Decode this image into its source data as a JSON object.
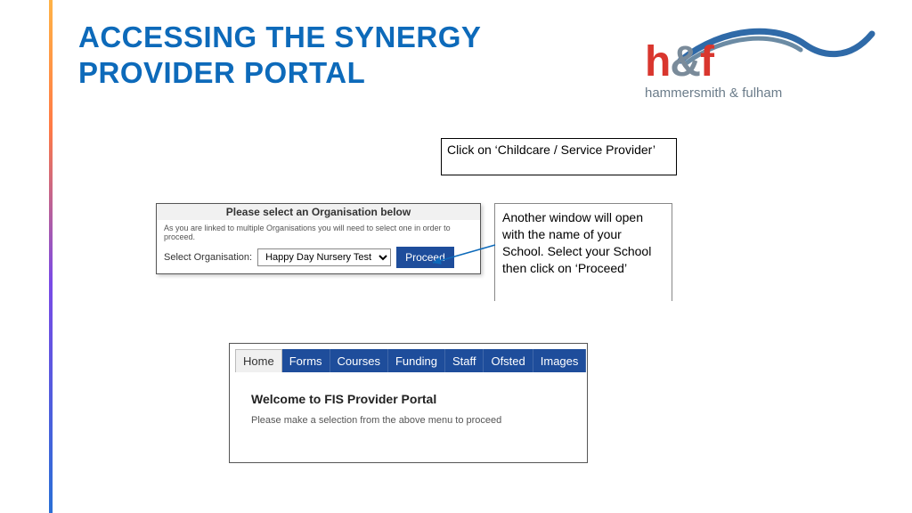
{
  "title": "Accessing the Synergy Provider Portal",
  "brand": {
    "h": "h",
    "amp": "&",
    "f": "f",
    "sub": "hammersmith & fulham"
  },
  "callout1": "Click on ‘Childcare / Service Provider’",
  "callout2": "Another window will open with the name of your School. Select your School then click on ‘Proceed’",
  "orgbox": {
    "head": "Please select an Organisation below",
    "sub": "As you are linked to multiple Organisations you will need to select one in order to proceed.",
    "label": "Select Organisation:",
    "selected": "Happy Day Nursery Test",
    "proceed": "Proceed"
  },
  "nav": {
    "tabs": [
      "Home",
      "Forms",
      "Courses",
      "Funding",
      "Staff",
      "Ofsted",
      "Images"
    ],
    "welcome": "Welcome to FIS Provider Portal",
    "welcome_sub": "Please make a selection from the above menu to proceed"
  }
}
